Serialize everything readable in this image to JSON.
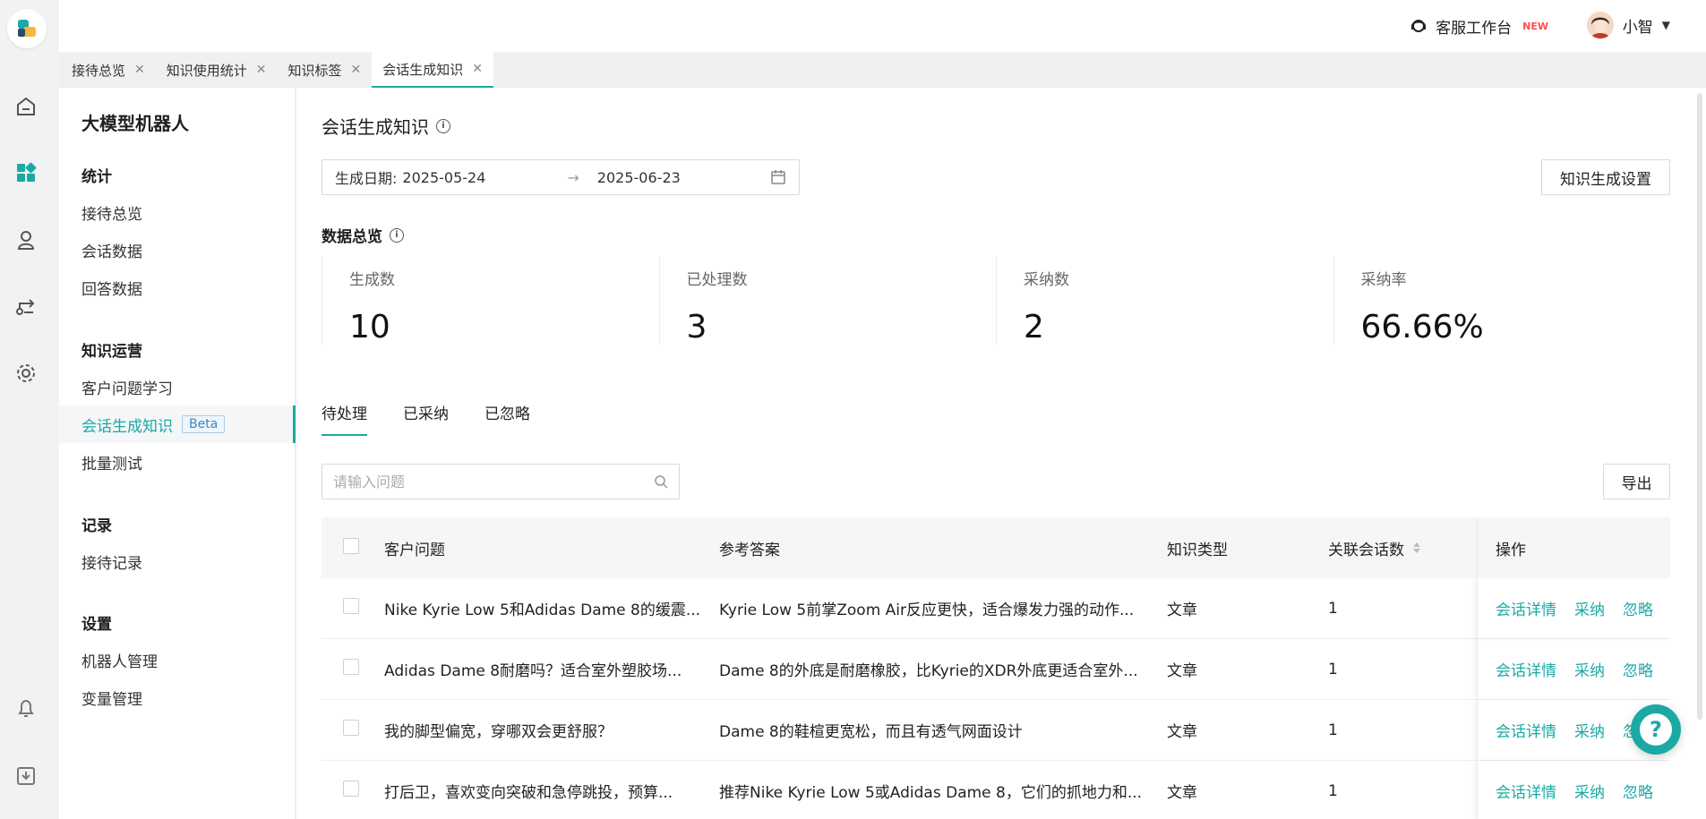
{
  "header": {
    "service_label": "客服工作台",
    "service_badge": "NEW",
    "user_name": "小智"
  },
  "tabs": [
    {
      "label": "接待总览"
    },
    {
      "label": "知识使用统计"
    },
    {
      "label": "知识标签"
    },
    {
      "label": "会话生成知识",
      "active": true
    }
  ],
  "sidenav": {
    "title": "大模型机器人",
    "groups": [
      {
        "label": "统计",
        "items": [
          "接待总览",
          "会话数据",
          "回答数据"
        ]
      },
      {
        "label": "知识运营",
        "items": [
          "客户问题学习",
          "会话生成知识",
          "批量测试"
        ]
      },
      {
        "label": "记录",
        "items": [
          "接待记录"
        ]
      },
      {
        "label": "设置",
        "items": [
          "机器人管理",
          "变量管理"
        ]
      }
    ],
    "active_item": "会话生成知识",
    "beta_label": "Beta"
  },
  "page": {
    "title": "会话生成知识",
    "date_label": "生成日期:",
    "date_start": "2025-05-24",
    "date_end": "2025-06-23",
    "settings_button": "知识生成设置",
    "overview_title": "数据总览"
  },
  "stats": [
    {
      "label": "生成数",
      "value": "10"
    },
    {
      "label": "已处理数",
      "value": "3"
    },
    {
      "label": "采纳数",
      "value": "2"
    },
    {
      "label": "采纳率",
      "value": "66.66%"
    }
  ],
  "content_tabs": [
    "待处理",
    "已采纳",
    "已忽略"
  ],
  "search": {
    "placeholder": "请输入问题"
  },
  "export_button": "导出",
  "table": {
    "headers": {
      "question": "客户问题",
      "answer": "参考答案",
      "type": "知识类型",
      "count": "关联会话数",
      "ops": "操作"
    },
    "actions": {
      "detail": "会话详情",
      "adopt": "采纳",
      "ignore": "忽略"
    },
    "rows": [
      {
        "question": "Nike Kyrie Low 5和Adidas Dame 8的缓震...",
        "answer": "Kyrie Low 5前掌Zoom Air反应更快，适合爆发力强的动作...",
        "type": "文章",
        "count": "1"
      },
      {
        "question": "Adidas Dame 8耐磨吗？适合室外塑胶场...",
        "answer": "Dame 8的外底是耐磨橡胶，比Kyrie的XDR外底更适合室外...",
        "type": "文章",
        "count": "1"
      },
      {
        "question": "我的脚型偏宽，穿哪双会更舒服？",
        "answer": "Dame 8的鞋楦更宽松，而且有透气网面设计",
        "type": "文章",
        "count": "1"
      },
      {
        "question": "打后卫，喜欢变向突破和急停跳投，预算...",
        "answer": "推荐Nike Kyrie Low 5或Adidas Dame 8，它们的抓地力和...",
        "type": "文章",
        "count": "1"
      }
    ]
  },
  "colors": {
    "accent": "#1aa9a5",
    "new_badge": "#ff4d4f"
  }
}
